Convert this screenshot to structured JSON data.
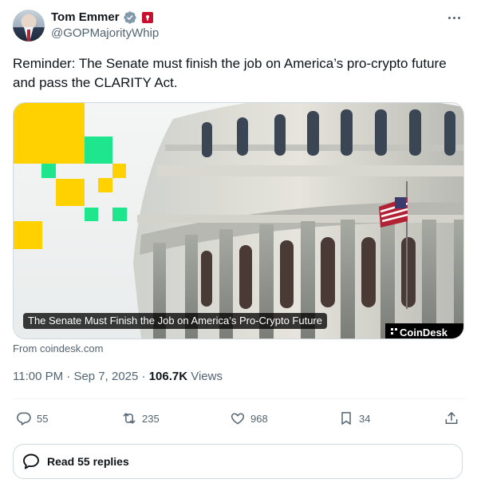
{
  "author": {
    "name": "Tom Emmer",
    "handle": "@GOPMajorityWhip"
  },
  "tweet": {
    "text": "Reminder: The Senate must finish the job on America’s pro-crypto future and pass the CLARITY Act."
  },
  "card": {
    "caption": "The Senate Must Finish the Job on America’s Pro-Crypto Future",
    "logo_text": "CoinDesk",
    "source": "From coindesk.com"
  },
  "meta": {
    "time": "11:00 PM",
    "separator": "·",
    "date": "Sep 7, 2025",
    "views_count": "106.7K",
    "views_label": "Views"
  },
  "actions": {
    "replies": "55",
    "reposts": "235",
    "likes": "968",
    "bookmarks": "34"
  },
  "read_replies": {
    "label": "Read 55 replies"
  },
  "colors": {
    "verified": "#829aab",
    "accent_yellow": "#ffd100",
    "accent_green": "#1ee68c",
    "flag_red": "#c8102e"
  },
  "icons": {
    "more": "more-dots-icon",
    "reply": "reply-icon",
    "repost": "repost-icon",
    "like": "heart-icon",
    "bookmark": "bookmark-icon",
    "share": "share-icon",
    "replies_button": "speech-bubble-icon"
  }
}
